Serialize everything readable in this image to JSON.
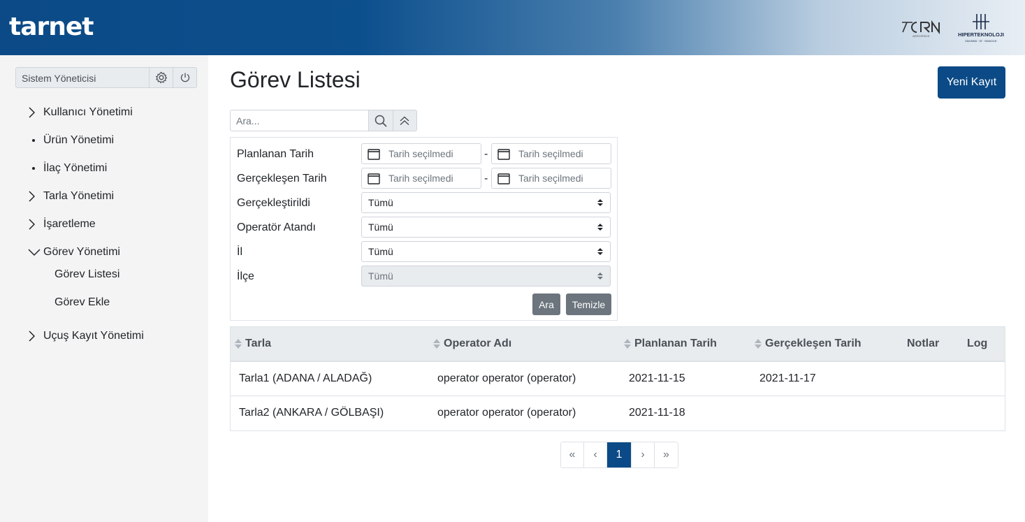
{
  "brand": {
    "logo": "tarnet",
    "partner1": "CRN",
    "partner1_sub": "AEROSPACE",
    "partner2": "HIPERTEKNOLOJI",
    "partner2_sub": "SAVUNMA · VE · HAVACILIK"
  },
  "sidebar": {
    "user": "Sistem Yöneticisi",
    "items": [
      {
        "label": "Kullanıcı Yönetimi"
      },
      {
        "label": "Ürün Yönetimi"
      },
      {
        "label": "İlaç Yönetimi"
      },
      {
        "label": "Tarla Yönetimi"
      },
      {
        "label": "İşaretleme"
      },
      {
        "label": "Görev Yönetimi"
      },
      {
        "label": "Uçuş Kayıt Yönetimi"
      }
    ],
    "sub_items": [
      {
        "label": "Görev Listesi"
      },
      {
        "label": "Görev Ekle"
      }
    ]
  },
  "page": {
    "title": "Görev Listesi",
    "new_button": "Yeni Kayıt"
  },
  "search": {
    "placeholder": "Ara..."
  },
  "filters": {
    "planned_label": "Planlanan Tarih",
    "actual_label": "Gerçekleşen Tarih",
    "date_placeholder": "Tarih seçilmedi",
    "dash": "-",
    "done_label": "Gerçekleştirildi",
    "done_value": "Tümü",
    "operator_label": "Operatör Atandı",
    "operator_value": "Tümü",
    "province_label": "İl",
    "province_value": "Tümü",
    "district_label": "İlçe",
    "district_value": "Tümü",
    "search_button": "Ara",
    "clear_button": "Temizle"
  },
  "table": {
    "headers": [
      "Tarla",
      "Operator Adı",
      "Planlanan Tarih",
      "Gerçekleşen Tarih",
      "Notlar",
      "Log"
    ],
    "rows": [
      [
        "Tarla1 (ADANA / ALADAĞ)",
        "operator operator (operator)",
        "2021-11-15",
        "2021-11-17",
        "",
        ""
      ],
      [
        "Tarla2 (ANKARA / GÖLBAŞI)",
        "operator operator (operator)",
        "2021-11-18",
        "",
        "",
        ""
      ]
    ]
  },
  "pagination": {
    "first": "«",
    "prev": "‹",
    "current": "1",
    "next": "›",
    "last": "»"
  }
}
